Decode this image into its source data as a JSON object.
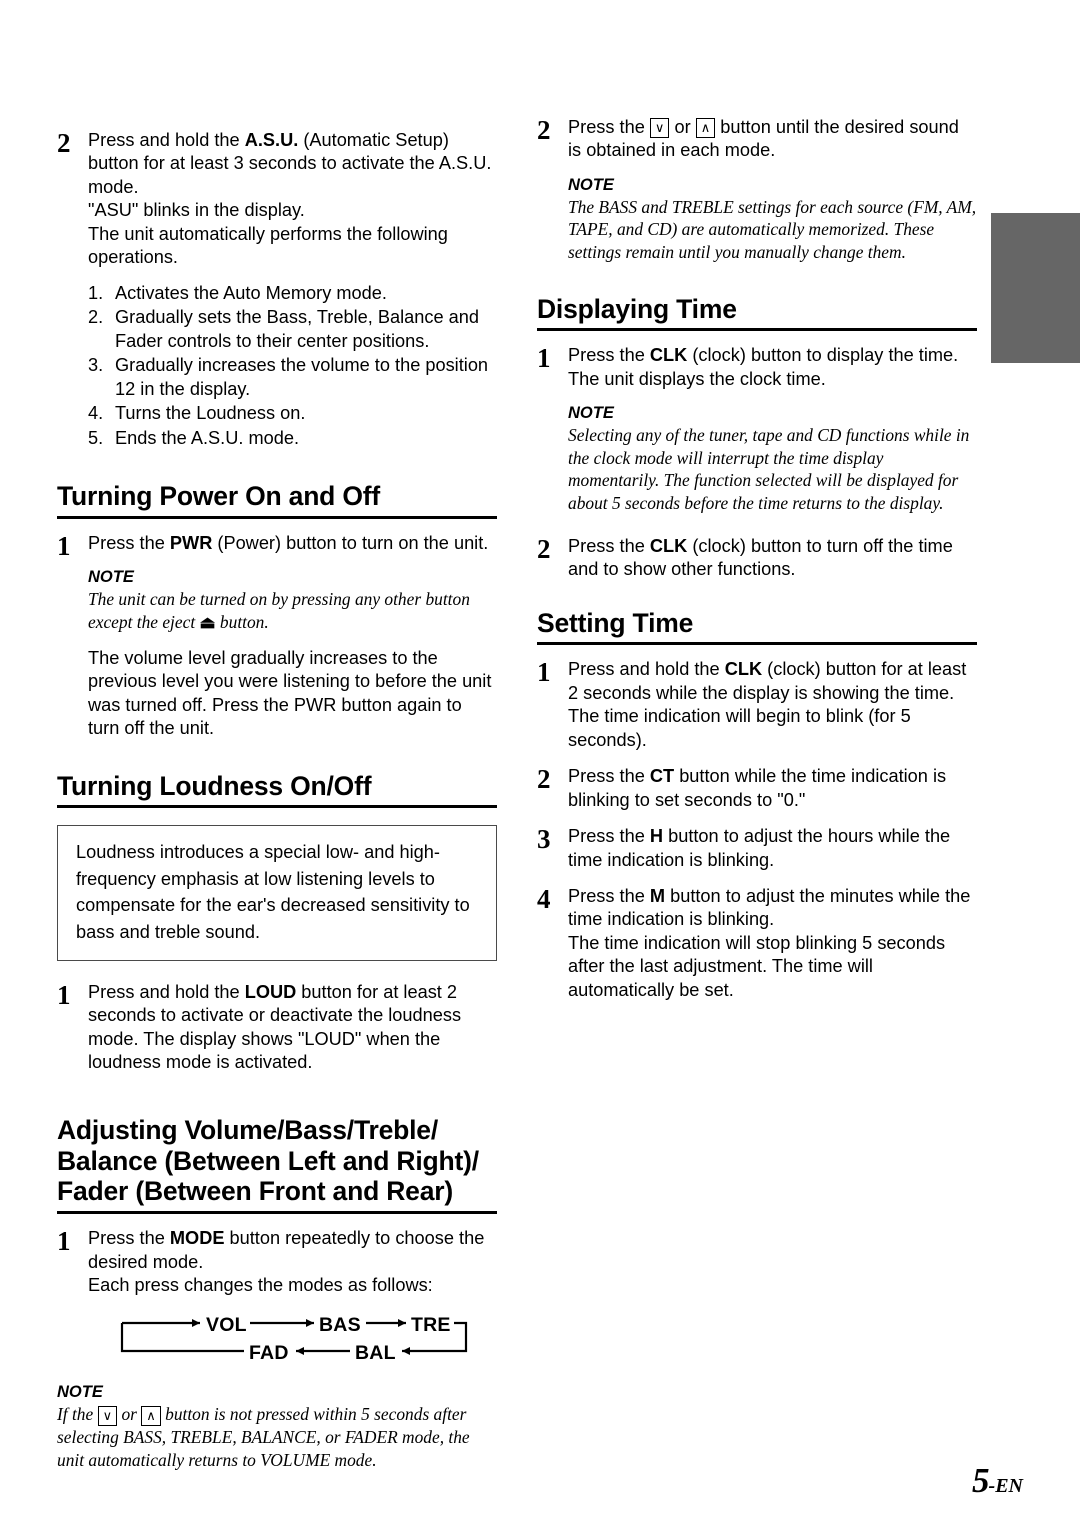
{
  "page": {
    "folio_number": "5",
    "folio_suffix": "-EN",
    "edge_tab_color": "#666666"
  },
  "left_column": {
    "step_asu": {
      "number": "2",
      "lines": [
        "Press and hold the A.S.U. (Automatic Setup) button for at least 3 seconds to activate the A.S.U. mode.",
        "\"ASU\" blinks in the display.",
        "The unit automatically performs the following operations."
      ],
      "bold_terms": [
        "A.S.U."
      ],
      "sublist": [
        {
          "marker": "1.",
          "text": "Activates the Auto Memory mode."
        },
        {
          "marker": "2.",
          "text": "Gradually sets the Bass, Treble, Balance and Fader controls to their center positions."
        },
        {
          "marker": "3.",
          "text": "Gradually increases the volume to the position 12 in the display."
        },
        {
          "marker": "4.",
          "text": "Turns the Loudness on."
        },
        {
          "marker": "5.",
          "text": "Ends the A.S.U. mode."
        }
      ]
    },
    "power_section": {
      "heading": "Turning Power On and Off",
      "step1": {
        "number": "1",
        "text_before_bold": "Press the ",
        "bold": "PWR",
        "text_after_bold": " (Power) button to turn on the unit."
      },
      "note": {
        "label": "NOTE",
        "text_part1": "The unit can be turned on by pressing any other button except the eject ",
        "eject_icon": "⏏",
        "text_part2": " button."
      },
      "paragraph": "The volume level gradually increases to the previous level you were listening to before the unit was turned off. Press the PWR button again to turn off the unit."
    },
    "loudness_section": {
      "heading": "Turning Loudness On/Off",
      "infobox": "Loudness introduces a special low- and high-frequency emphasis at low listening levels to compensate for the ear's decreased sensitivity to bass and treble sound.",
      "step1": {
        "number": "1",
        "text_before_bold": "Press and hold the ",
        "bold": "LOUD",
        "text_after_bold": " button for at least 2 seconds to activate or deactivate the loudness mode. The display shows \"LOUD\" when the loudness mode is activated."
      }
    },
    "adjusting_section": {
      "heading_line1": "Adjusting Volume/Bass/Treble/",
      "heading_line2": "Balance (Between Left and Right)/",
      "heading_line3": "Fader (Between Front and Rear)",
      "step1": {
        "number": "1",
        "text_before_bold": "Press the ",
        "bold": "MODE",
        "text_after_bold": " button repeatedly to choose the desired mode.",
        "second_line": "Each press changes the modes as follows:"
      },
      "mode_cycle": {
        "top_row": [
          "VOL",
          "BAS",
          "TRE"
        ],
        "bottom_row": [
          "FAD",
          "BAL"
        ]
      },
      "note": {
        "label": "NOTE",
        "text_part1": "If the ",
        "key_down": "∨",
        "text_part2": " or ",
        "key_up": "∧",
        "text_part3": " button is not pressed within 5 seconds after selecting BASS, TREBLE, BALANCE, or FADER mode, the unit automatically returns to VOLUME mode."
      }
    }
  },
  "right_column": {
    "step_sound": {
      "number": "2",
      "text_part1": "Press the ",
      "key_down": "∨",
      "text_part2": " or ",
      "key_up": "∧",
      "text_part3": " button until the desired sound is obtained in each mode."
    },
    "note_bass_treble": {
      "label": "NOTE",
      "text": "The BASS and TREBLE settings for each source (FM, AM, TAPE, and CD) are automatically memorized. These settings remain until you manually change them."
    },
    "displaying_time_section": {
      "heading": "Displaying Time",
      "step1": {
        "number": "1",
        "text_before_bold": "Press the ",
        "bold": "CLK",
        "text_after_bold": " (clock) button to display the time. The unit displays the clock time."
      },
      "note": {
        "label": "NOTE",
        "text": "Selecting any of the tuner, tape and CD functions while in the clock mode will interrupt the time display momentarily. The function selected will be displayed for about 5 seconds before the time returns to the display."
      },
      "step2": {
        "number": "2",
        "text_before_bold": "Press the ",
        "bold": "CLK",
        "text_after_bold": " (clock) button to turn off the time and to show other functions."
      }
    },
    "setting_time_section": {
      "heading": "Setting Time",
      "step1": {
        "number": "1",
        "text_before_bold": "Press and hold the ",
        "bold": "CLK",
        "text_after_bold": " (clock) button for at least 2 seconds while the display is showing the time.",
        "second_line": "The time indication will begin to blink (for 5 seconds)."
      },
      "step2": {
        "number": "2",
        "text_before_bold": "Press the ",
        "bold": "CT",
        "text_after_bold": " button while the time indication is blinking to set seconds to \"0.\""
      },
      "step3": {
        "number": "3",
        "text_before_bold": "Press the ",
        "bold": "H",
        "text_after_bold": " button to adjust the hours while the time indication is blinking."
      },
      "step4": {
        "number": "4",
        "text_before_bold": "Press the ",
        "bold": "M",
        "text_after_bold": " button to adjust the minutes while the time indication is blinking.",
        "second_line": "The time indication will stop blinking 5 seconds after the last adjustment. The time will automatically be set."
      }
    }
  }
}
